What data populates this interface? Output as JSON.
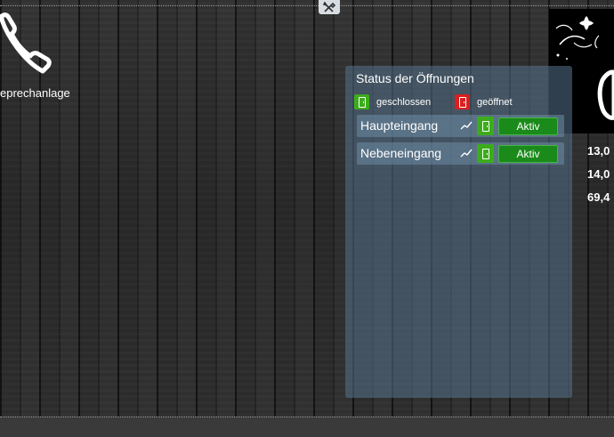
{
  "app": {
    "intercom_label": "eprechanlage"
  },
  "status_panel": {
    "title": "Status der Öffnungen",
    "legend": {
      "closed_label": "geschlossen",
      "open_label": "geöffnet"
    },
    "rows": [
      {
        "label": "Haupteingang",
        "button_label": "Aktiv"
      },
      {
        "label": "Nebeneingang",
        "button_label": "Aktiv"
      }
    ]
  },
  "side_values": [
    "13,0",
    "14,0",
    "69,4"
  ],
  "colors": {
    "closed": "#3cac1c",
    "open": "#d91f1f",
    "active_button": "#1a8a1a",
    "panel": "#55738c"
  },
  "icons": {
    "toolbar": "tools-icon",
    "intercom": "phone-icon",
    "trend": "trend-icon",
    "closed": "door-closed-icon",
    "open": "door-open-icon"
  }
}
